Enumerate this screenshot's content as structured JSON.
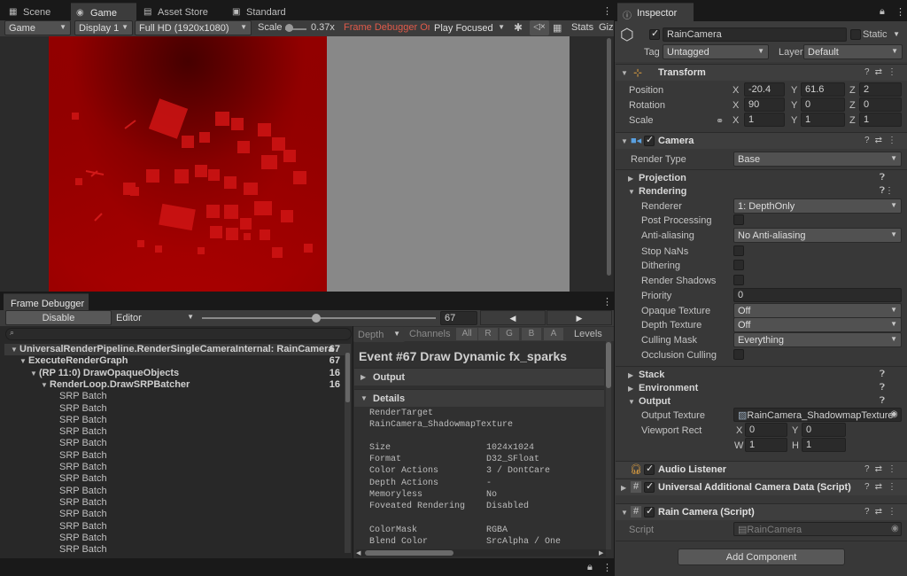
{
  "tabs": [
    {
      "label": "Scene",
      "icon": "scene-icon"
    },
    {
      "label": "Game",
      "icon": "game-icon"
    },
    {
      "label": "Asset Store",
      "icon": "store-icon"
    },
    {
      "label": "Standard",
      "icon": "lock-icon"
    }
  ],
  "game_toolbar": {
    "display_mode": "Game",
    "display": "Display 1",
    "resolution": "Full HD (1920x1080)",
    "scale_label": "Scale",
    "scale_value": "0.37x",
    "frame_debugger": "Frame Debugger On",
    "play_mode": "Play Focused",
    "stats": "Stats",
    "gizmos": "Giz"
  },
  "frame_debugger": {
    "title": "Frame Debugger",
    "disable_label": "Disable",
    "target": "Editor",
    "event_index": "67",
    "slider_fraction": 0.49,
    "filters": {
      "depth": "Depth",
      "channels": "Channels",
      "all": "All",
      "r": "R",
      "g": "G",
      "b": "B",
      "a": "A",
      "levels": "Levels"
    },
    "tree": [
      {
        "label": "UniversalRenderPipeline.RenderSingleCameraInternal: RainCamera",
        "count": "67",
        "level": 0
      },
      {
        "label": "ExecuteRenderGraph",
        "count": "67",
        "level": 1
      },
      {
        "label": "(RP 11:0) DrawOpaqueObjects",
        "count": "16",
        "level": 2
      },
      {
        "label": "RenderLoop.DrawSRPBatcher",
        "count": "16",
        "level": 3
      },
      {
        "label": "SRP Batch",
        "count": "",
        "level": 4
      },
      {
        "label": "SRP Batch",
        "count": "",
        "level": 4
      },
      {
        "label": "SRP Batch",
        "count": "",
        "level": 4
      },
      {
        "label": "SRP Batch",
        "count": "",
        "level": 4
      },
      {
        "label": "SRP Batch",
        "count": "",
        "level": 4
      },
      {
        "label": "SRP Batch",
        "count": "",
        "level": 4
      },
      {
        "label": "SRP Batch",
        "count": "",
        "level": 4
      },
      {
        "label": "SRP Batch",
        "count": "",
        "level": 4
      },
      {
        "label": "SRP Batch",
        "count": "",
        "level": 4
      },
      {
        "label": "SRP Batch",
        "count": "",
        "level": 4
      },
      {
        "label": "SRP Batch",
        "count": "",
        "level": 4
      },
      {
        "label": "SRP Batch",
        "count": "",
        "level": 4
      },
      {
        "label": "SRP Batch",
        "count": "",
        "level": 4
      },
      {
        "label": "SRP Batch",
        "count": "",
        "level": 4
      }
    ],
    "event_title": "Event #67 Draw Dynamic fx_sparks",
    "output_label": "Output",
    "details_label": "Details",
    "render_target_label": "RenderTarget",
    "render_target": "RainCamera_ShadowmapTexture",
    "details": [
      [
        "Size",
        "1024x1024"
      ],
      [
        "Format",
        "D32_SFloat"
      ],
      [
        "Color Actions",
        "3 / DontCare"
      ],
      [
        "Depth Actions",
        "-"
      ],
      [
        "Memoryless",
        "No"
      ],
      [
        "Foveated Rendering",
        "Disabled"
      ]
    ],
    "details2": [
      [
        "ColorMask",
        "RGBA"
      ],
      [
        "Blend Color",
        "SrcAlpha / One"
      ]
    ]
  },
  "inspector": {
    "title": "Inspector",
    "object_name": "RainCamera",
    "static_label": "Static",
    "tag_label": "Tag",
    "tag": "Untagged",
    "layer_label": "Layer",
    "layer": "Default",
    "transform": {
      "title": "Transform",
      "position_label": "Position",
      "rotation_label": "Rotation",
      "scale_label": "Scale",
      "position": {
        "x": "-20.4",
        "y": "61.6",
        "z": "2"
      },
      "rotation": {
        "x": "90",
        "y": "0",
        "z": "0"
      },
      "scale": {
        "x": "1",
        "y": "1",
        "z": "1"
      }
    },
    "camera": {
      "title": "Camera",
      "render_type_label": "Render Type",
      "render_type": "Base",
      "projection": "Projection",
      "rendering": "Rendering",
      "renderer_label": "Renderer",
      "renderer": "1: DepthOnly",
      "post_processing": "Post Processing",
      "anti_aliasing_label": "Anti-aliasing",
      "anti_aliasing": "No Anti-aliasing",
      "stop_nans": "Stop NaNs",
      "dithering": "Dithering",
      "render_shadows": "Render Shadows",
      "priority_label": "Priority",
      "priority": "0",
      "opaque_texture_label": "Opaque Texture",
      "opaque_texture": "Off",
      "depth_texture_label": "Depth Texture",
      "depth_texture": "Off",
      "culling_mask_label": "Culling Mask",
      "culling_mask": "Everything",
      "occlusion_culling": "Occlusion Culling",
      "stack": "Stack",
      "environment": "Environment",
      "output": "Output",
      "output_texture_label": "Output Texture",
      "output_texture": "RainCamera_ShadowmapTexture",
      "viewport_label": "Viewport Rect",
      "vx": "0",
      "vy": "0",
      "vw": "1",
      "vh": "1"
    },
    "audio_listener": "Audio Listener",
    "urp_data": "Universal Additional Camera Data (Script)",
    "rain_camera": "Rain Camera (Script)",
    "script_label": "Script",
    "script_value": "RainCamera",
    "add_component": "Add Component"
  },
  "axis_labels": {
    "x": "X",
    "y": "Y",
    "z": "Z",
    "w": "W",
    "h": "H"
  }
}
